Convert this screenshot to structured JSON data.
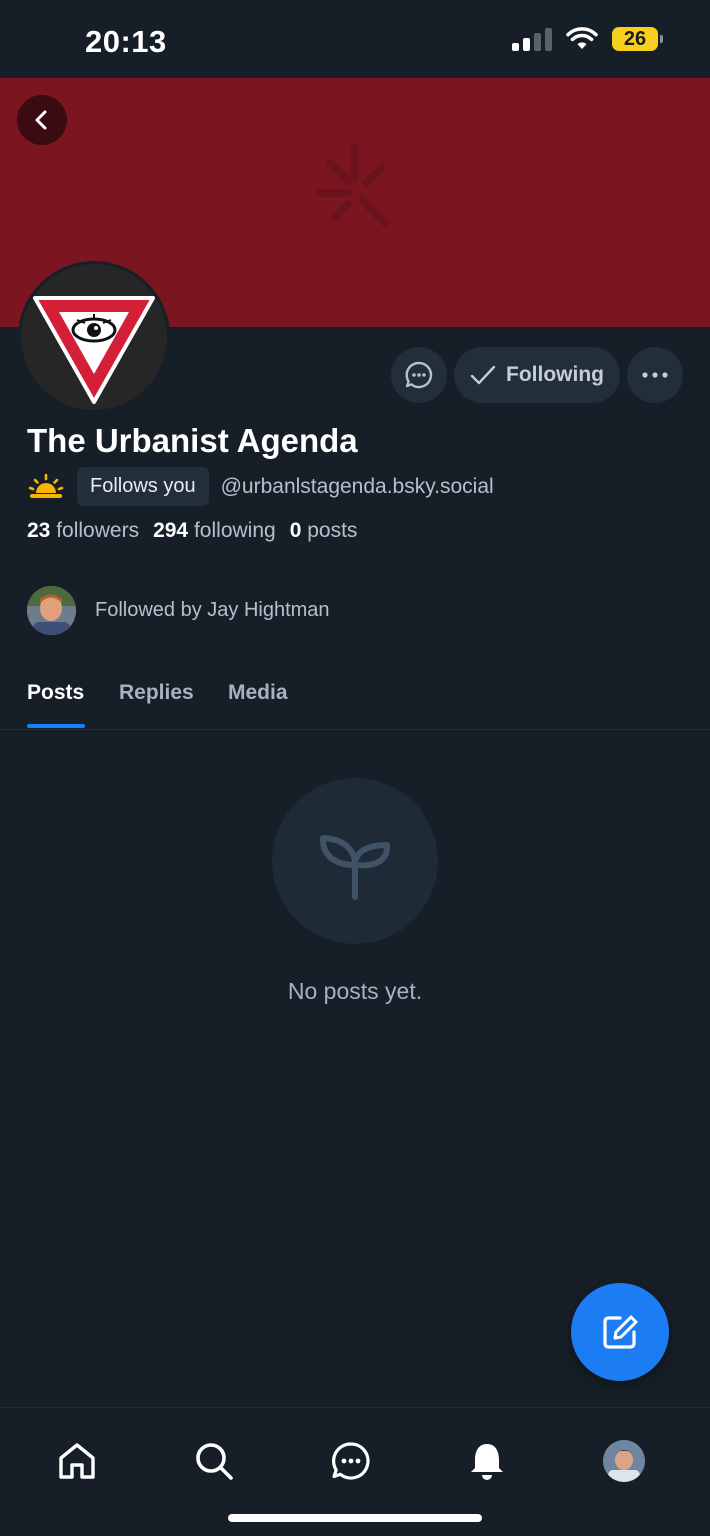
{
  "status_bar": {
    "time": "20:13",
    "battery": "26",
    "icons": [
      "cellular-signal-icon",
      "wifi-icon",
      "battery-icon"
    ]
  },
  "header": {
    "back_icon": "chevron-left-icon"
  },
  "profile": {
    "display_name": "The Urbanist Agenda",
    "follows_you_label": "Follows you",
    "handle": "@urbanlstagenda.bsky.social",
    "emoji": "🌅",
    "stats": {
      "followers_count": "23",
      "followers_label": "followers",
      "following_count": "294",
      "following_label": "following",
      "posts_count": "0",
      "posts_label": "posts"
    },
    "followed_by": "Followed by Jay Hightman"
  },
  "actions": {
    "message_icon": "chat-bubble-icon",
    "following_label": "Following",
    "more_icon": "ellipsis-icon"
  },
  "tabs": [
    {
      "label": "Posts",
      "active": true
    },
    {
      "label": "Replies",
      "active": false
    },
    {
      "label": "Media",
      "active": false
    }
  ],
  "empty_state": {
    "icon": "sprout-icon",
    "message": "No posts yet."
  },
  "fab": {
    "icon": "compose-icon"
  },
  "bottom_nav": [
    "home-icon",
    "search-icon",
    "chat-icon",
    "bell-icon",
    "profile-avatar"
  ],
  "colors": {
    "background": "#161e27",
    "banner": "#7b1620",
    "accent": "#1083fe",
    "fab": "#1b7cf4"
  }
}
